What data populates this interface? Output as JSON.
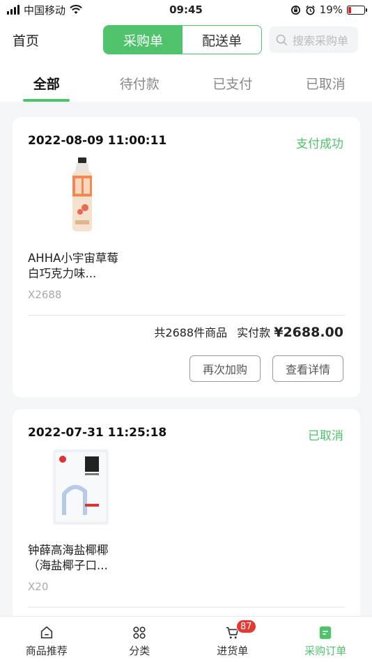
{
  "status_bar": {
    "carrier": "中国移动",
    "time": "09:45",
    "battery": "19%",
    "battery_level": 0.19,
    "icons": [
      "signal-icon",
      "wifi-icon",
      "orientation-lock-icon",
      "alarm-icon",
      "battery-icon"
    ]
  },
  "header": {
    "home_label": "首页",
    "segments": [
      "采购单",
      "配送单"
    ],
    "active_segment": "采购单",
    "search_placeholder": "搜索采购单"
  },
  "tabs": [
    "全部",
    "待付款",
    "已支付",
    "已取消"
  ],
  "active_tab": "全部",
  "orders": [
    {
      "date": "2022-08-09 11:00:11",
      "status": "支付成功",
      "product_name": "AHHA小宇宙草莓白巧克力味...",
      "quantity": "X2688",
      "summary_count": "共2688件商品",
      "paid_label": "实付款",
      "paid_amount": "¥2688.00",
      "buttons": [
        "再次加购",
        "查看详情"
      ]
    },
    {
      "date": "2022-07-31 11:25:18",
      "status": "已取消",
      "product_name": "钟薛高海盐椰椰（海盐椰子口...",
      "quantity": "X20"
    }
  ],
  "bottom_nav": [
    {
      "label": "商品推荐",
      "icon": "home-icon"
    },
    {
      "label": "分类",
      "icon": "grid-icon"
    },
    {
      "label": "进货单",
      "icon": "cart-icon",
      "badge": "87"
    },
    {
      "label": "采购订单",
      "icon": "order-icon"
    }
  ],
  "colors": {
    "accent": "#4fc26b",
    "badge": "#e53935"
  }
}
